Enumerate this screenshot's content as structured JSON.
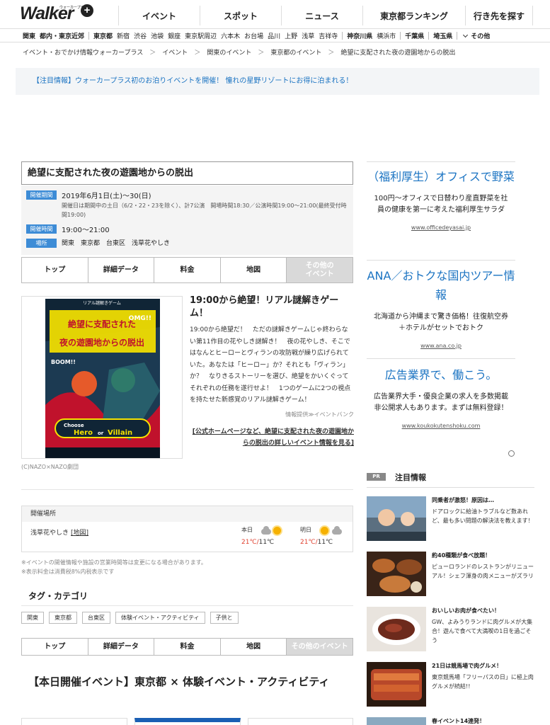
{
  "header": {
    "logo": "Walker",
    "logo_sub": "ウォーカープラス",
    "logo_plus": "+",
    "nav": [
      "イベント",
      "スポット",
      "ニュース",
      "東京都ランキング",
      "行き先を探す"
    ]
  },
  "areas": [
    {
      "label": "関東",
      "bold": true
    },
    {
      "label": "都内・東京近郊",
      "bold": true
    },
    {
      "sep": true
    },
    {
      "label": "東京都",
      "bold": true
    },
    {
      "label": "新宿"
    },
    {
      "label": "渋谷"
    },
    {
      "label": "池袋"
    },
    {
      "label": "銀座"
    },
    {
      "label": "東京駅周辺"
    },
    {
      "label": "六本木"
    },
    {
      "label": "お台場"
    },
    {
      "label": "品川"
    },
    {
      "label": "上野"
    },
    {
      "label": "浅草"
    },
    {
      "label": "吉祥寺"
    },
    {
      "sep": true
    },
    {
      "label": "神奈川県",
      "bold": true
    },
    {
      "label": "横浜市"
    },
    {
      "sep": true
    },
    {
      "label": "千葉県",
      "bold": true
    },
    {
      "sep": true
    },
    {
      "label": "埼玉県",
      "bold": true
    },
    {
      "sep": true
    }
  ],
  "areas_more": "その他",
  "breadcrumb": [
    "イベント・おでかけ情報ウォーカープラス",
    "イベント",
    "関東のイベント",
    "東京都のイベント",
    "絶望に支配された夜の遊園地からの脱出"
  ],
  "breadcrumb_sep": "＞",
  "notice": "【注目情報】ウォーカープラス初のお泊りイベントを開催！ 憧れの星野リゾートにお得に泊まれる！",
  "event": {
    "title": "絶望に支配された夜の遊園地からの脱出",
    "period_label": "開催期間",
    "period": "2019年6月1日(土)～30(日)",
    "period_note": "開催日は期間中の土日（6/2・22・23を除く）、計7公演　開場時間18:30／公演時間19:00～21:00(最終受付時間19:00)",
    "time_label": "開催時間",
    "time": "19:00～21:00",
    "place_label": "場所",
    "place": "関東　東京都　台東区　浅草花やしき",
    "heading": "19:00から絶望！リアル謎解きゲーム！",
    "description": "19:00から絶望だ！　ただの謎解きゲームじゃ終わらない第11作目の花やしき謎解き！　夜の花やしき、そこではなんとヒーローとヴィランの攻防戦が繰り広げられていた。あなたは「ヒーロー」か？それとも「ヴィラン」か？　なりきるストーリーを選び、絶望をかいくぐってそれぞれの任務を遂行せよ！　1つのゲームに2つの視点を持たせた新感覚のリアル謎解きゲーム！",
    "source": "情報提供≫イベントバンク",
    "link": "[公式ホームページなど、絶望に支配された夜の遊園地からの脱出の詳しいイベント情報を見る]",
    "credit": "(C)NAZO×NAZO劇団",
    "poster": {
      "top": "リアル謎解きゲーム",
      "line1": "絶望に支配された",
      "line2": "夜の遊園地からの脱出",
      "omg": "OMG!!",
      "boom": "BOOM!!",
      "choose": "Choose",
      "hero": "Hero",
      "or": "or",
      "villain": "Villain"
    }
  },
  "tabs": [
    "トップ",
    "詳細データ",
    "料金",
    "地図",
    "その他の\nイベント"
  ],
  "tabs2": [
    "トップ",
    "詳細データ",
    "料金",
    "地図",
    "その他のイベント"
  ],
  "venue": {
    "header": "開催場所",
    "name": "浅草花やしき",
    "map": "[地図]",
    "today_label": "本日",
    "today_hi": "21℃",
    "today_lo": "11℃",
    "tomorrow_label": "明日",
    "tomorrow_hi": "21℃",
    "tomorrow_lo": "11℃",
    "slash": "/"
  },
  "notes": [
    "※イベントの開催情報や施設の営業時間等は変更になる場合があります。",
    "※表示料金は消費税8%内税表示です"
  ],
  "tags": {
    "heading": "タグ・カテゴリ",
    "items": [
      "関東",
      "東京都",
      "台東区",
      "体験イベント・アクティビティ",
      "子供と"
    ]
  },
  "today_heading": "【本日開催イベント】東京都 × 体験イベント・アクティビティ",
  "ads": [
    {
      "title": "（福利厚生）オフィスで野菜",
      "body": "100円〜オフィスで日替わり産直野菜を社員の健康を第一に考えた福利厚生サラダ",
      "url": "www.officedeyasai.jp"
    },
    {
      "title": "ANA／おトクな国内ツアー情報",
      "body": "北海道から沖縄まで驚き価格！往復航空券＋ホテルがセットでおトク",
      "url": "www.ana.co.jp"
    },
    {
      "title": "広告業界で、働こう。",
      "body": "広告業界大手・優良企業の求人を多数掲載 非公開求人もあります。まずは無料登録！",
      "url": "www.koukokutenshoku.com"
    }
  ],
  "pickup": {
    "badge": "PR",
    "title": "注目情報",
    "items": [
      {
        "title": "同乗者が激怒！原因は…",
        "desc": "ドアロックに給油トラブルなど数あれど、最も多い問題の解決法を教えます！"
      },
      {
        "title": "約40種類が食べ放題！",
        "desc": "ピューロランドのレストランがリニューアル！シェフ渾身の肉メニューがズラリ"
      },
      {
        "title": "おいしいお肉が食べたい！",
        "desc": "GW、よみうりランドに肉グルメが大集合！遊んで食べて大満喫の1日を過ごそう"
      },
      {
        "title": "21日は競馬場で肉グルメ！",
        "desc": "東京競馬場「フリーパスの日」に極上肉グルメが続結!!"
      },
      {
        "title": "春イベント14連発！",
        "desc": ""
      }
    ]
  },
  "colors": {
    "accent": "#1a73c2",
    "label_bg": "#3d8cd6",
    "temp_hi": "#e0402f"
  }
}
